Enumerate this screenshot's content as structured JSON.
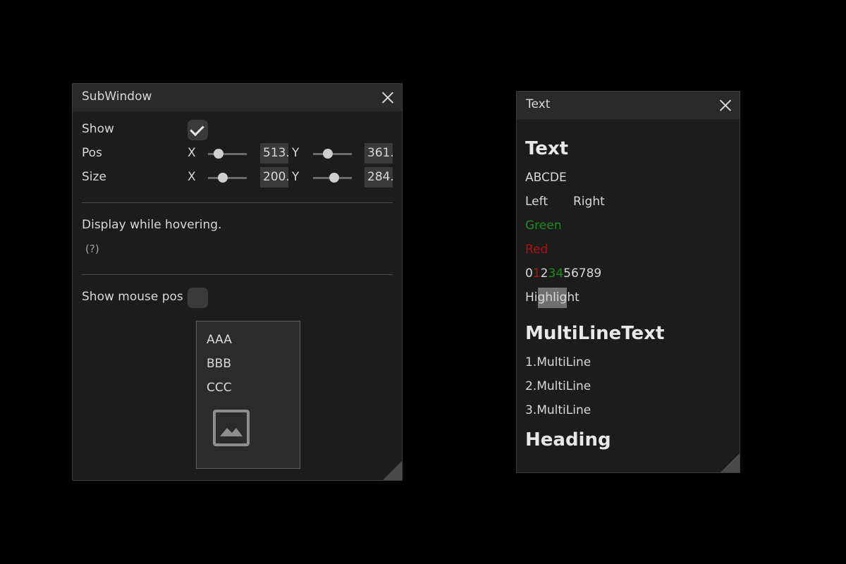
{
  "subwindow": {
    "title": "SubWindow",
    "show_label": "Show",
    "show_checked": true,
    "pos_label": "Pos",
    "size_label": "Size",
    "x_label": "X",
    "y_label": "Y",
    "pos_x": "513.",
    "pos_y": "361.",
    "size_x": "200.",
    "size_y": "284.",
    "hover_text": "Display while hovering.",
    "help_mark": "(?)",
    "show_mouse_pos_label": "Show mouse pos",
    "show_mouse_pos_checked": false,
    "list_items": [
      "AAA",
      "BBB",
      "CCC"
    ],
    "image_icon": "image-placeholder-icon"
  },
  "text_window": {
    "title": "Text",
    "heading_text": "Text",
    "abcde": "ABCDE",
    "left": "Left",
    "right": "Right",
    "green": "Green",
    "red": "Red",
    "digits": [
      "0",
      "1",
      "2",
      "3",
      "4",
      "56789"
    ],
    "highlight_parts": [
      "Hi",
      "ghlig",
      "ht"
    ],
    "multiline_heading": "MultiLineText",
    "multilines": [
      "1.MultiLine",
      "2.MultiLine",
      "3.MultiLine"
    ],
    "heading": "Heading"
  },
  "colors": {
    "background": "#000000",
    "window": "#1c1c1c",
    "titlebar": "#2a2a2a",
    "green": "#1f8a1f",
    "red": "#b01010",
    "highlight": "#707070"
  }
}
